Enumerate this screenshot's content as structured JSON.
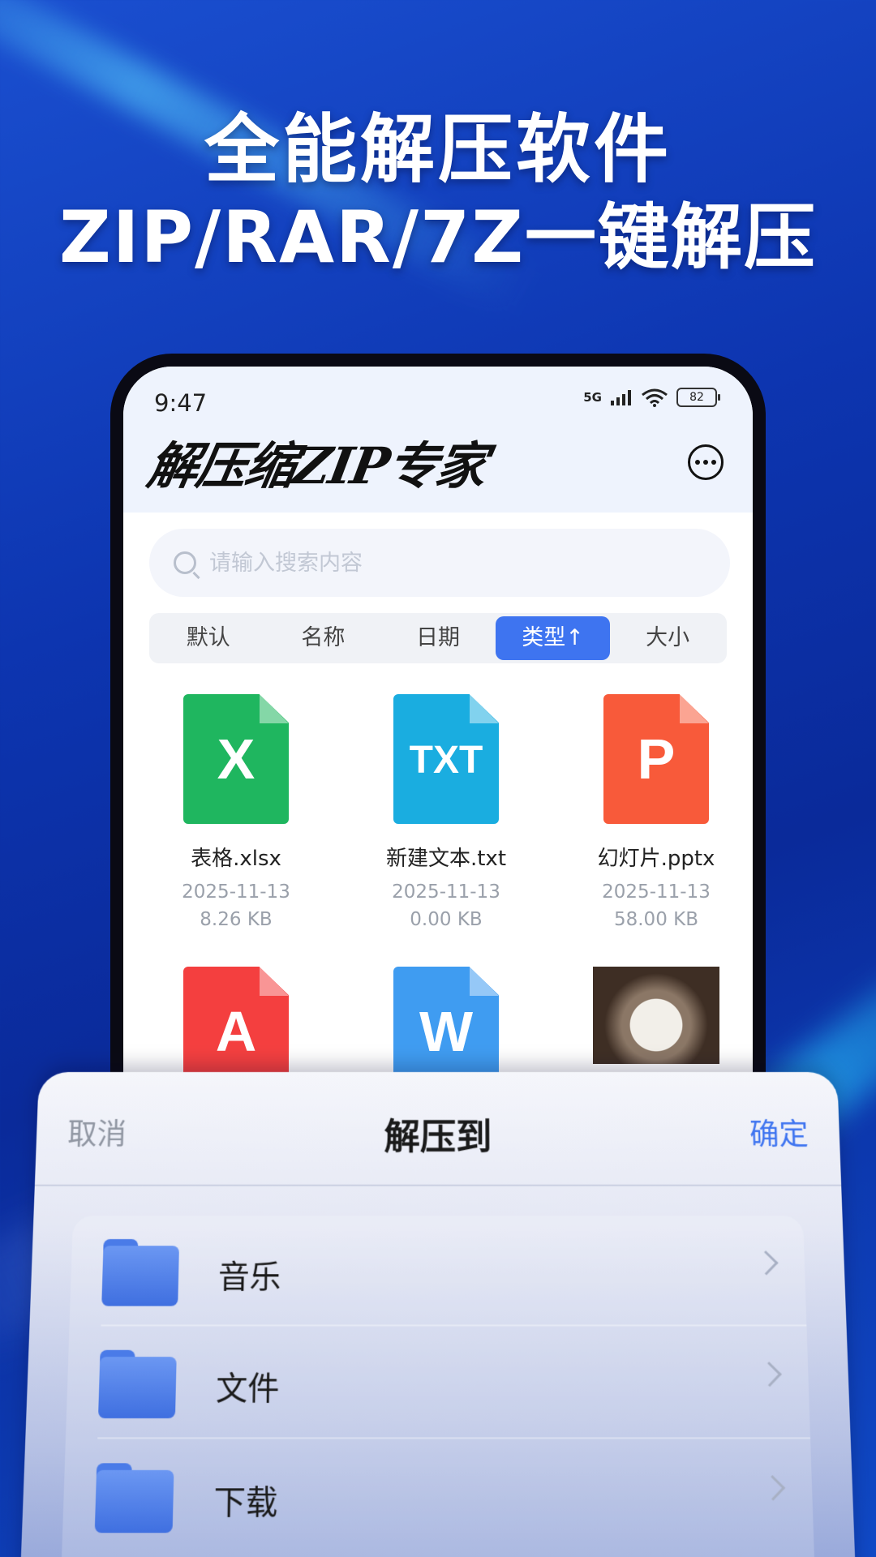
{
  "hero": {
    "line1": "全能解压软件",
    "line2": "ZIP/RAR/7Z一键解压"
  },
  "status_bar": {
    "time": "9:47",
    "signal": "5G",
    "battery": "82"
  },
  "app": {
    "logo": "解压缩ZIP专家",
    "more_icon": "more-dots-icon"
  },
  "search": {
    "placeholder": "请输入搜索内容",
    "value": ""
  },
  "sort_tabs": [
    {
      "label": "默认",
      "active": false
    },
    {
      "label": "名称",
      "active": false
    },
    {
      "label": "日期",
      "active": false
    },
    {
      "label": "类型↑",
      "active": true
    },
    {
      "label": "大小",
      "active": false
    }
  ],
  "files": [
    {
      "name": "表格.xlsx",
      "date": "2025-11-13",
      "size": "8.26 KB",
      "icon": "excel-file-icon",
      "glyph": "X",
      "color": "#1fb65f"
    },
    {
      "name": "新建文本.txt",
      "date": "2025-11-13",
      "size": "0.00 KB",
      "icon": "txt-file-icon",
      "glyph": "TXT",
      "color": "#1aade0"
    },
    {
      "name": "幻灯片.pptx",
      "date": "2025-11-13",
      "size": "58.00 KB",
      "icon": "ppt-file-icon",
      "glyph": "P",
      "color": "#f85a3a"
    },
    {
      "name": "",
      "date": "",
      "size": "",
      "icon": "pdf-file-icon",
      "glyph": "A",
      "color": "#f43f3f"
    },
    {
      "name": "",
      "date": "",
      "size": "",
      "icon": "word-file-icon",
      "glyph": "W",
      "color": "#3f9cf1"
    },
    {
      "name": "",
      "date": "",
      "size": "",
      "icon": "cat-photo-thumbnail",
      "glyph": "",
      "color": ""
    }
  ],
  "sheet": {
    "cancel": "取消",
    "title": "解压到",
    "confirm": "确定",
    "folders": [
      {
        "label": "音乐",
        "icon": "folder-icon"
      },
      {
        "label": "文件",
        "icon": "folder-icon"
      },
      {
        "label": "下载",
        "icon": "folder-icon"
      }
    ]
  },
  "colors": {
    "accent": "#3e74f0",
    "background": "#0d35b0"
  }
}
